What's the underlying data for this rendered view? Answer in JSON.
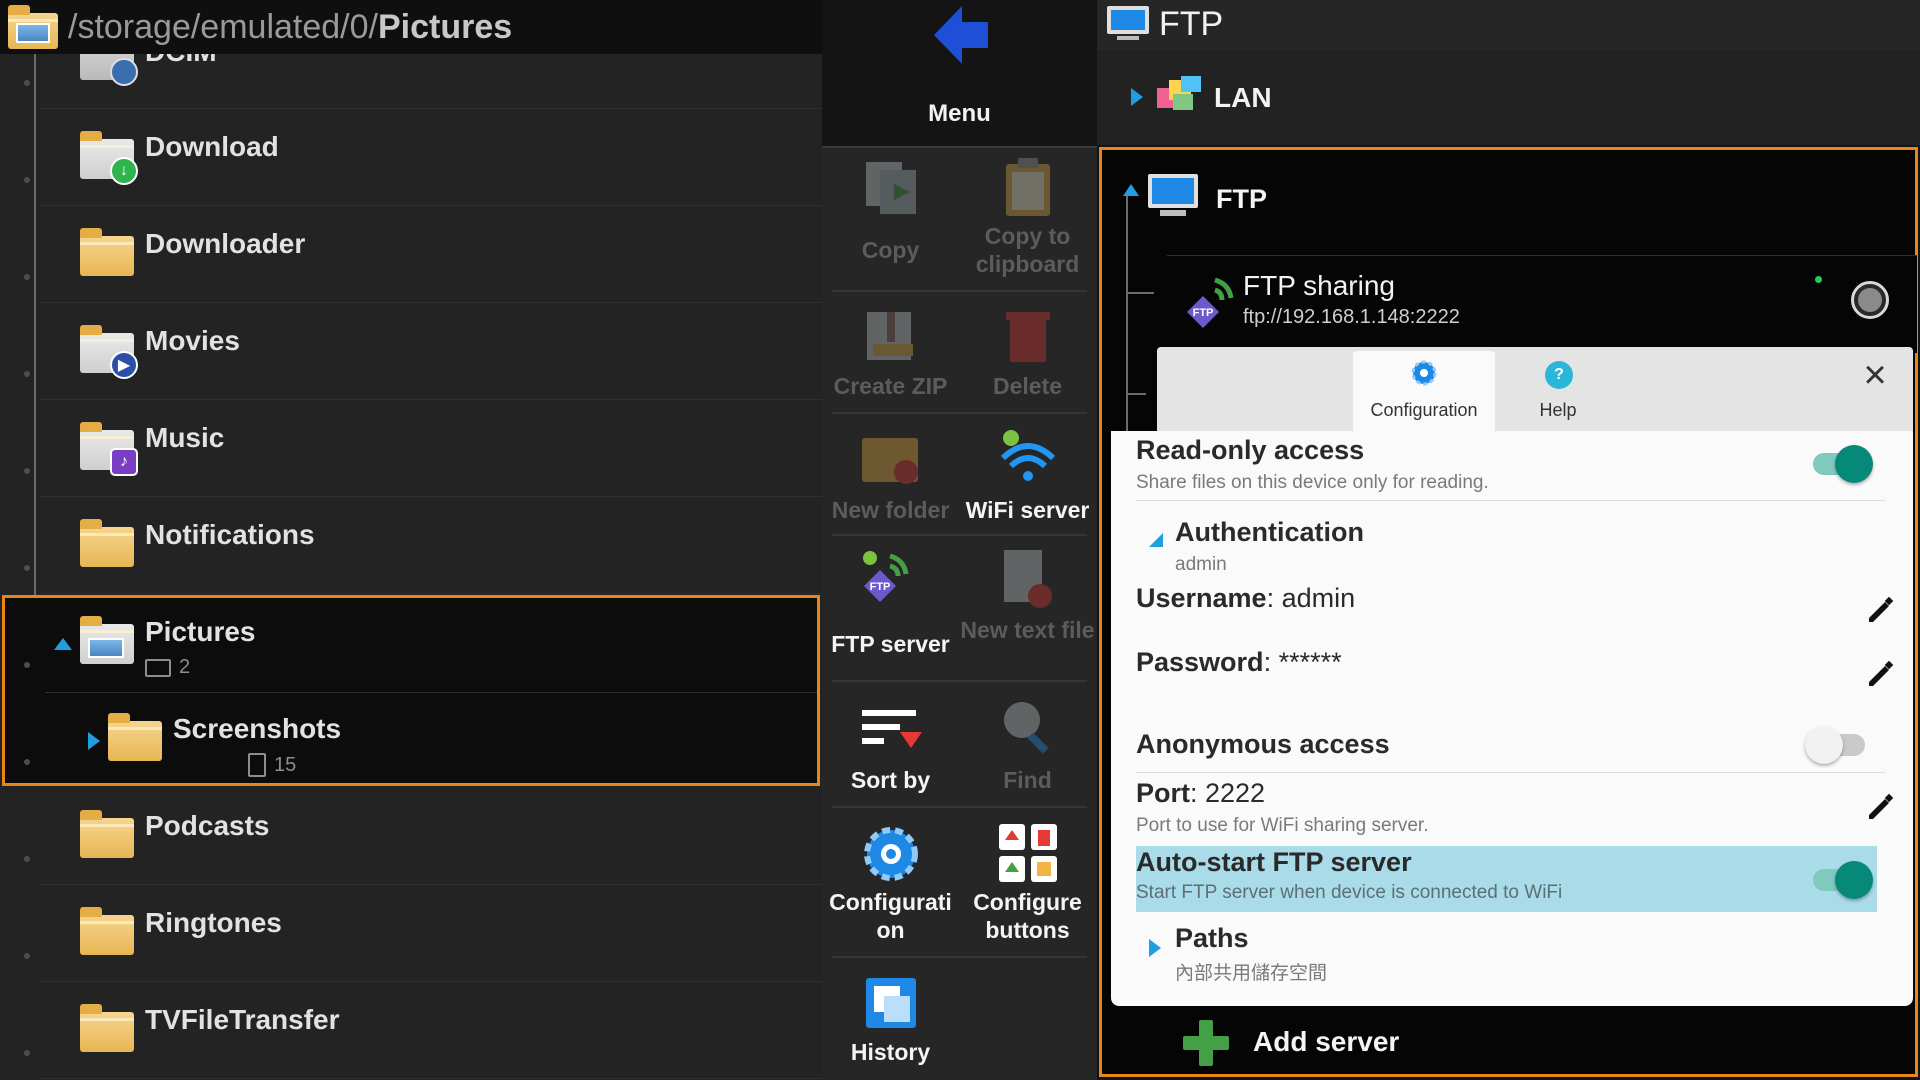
{
  "path_bar": {
    "prefix": "/storage/emulated/0/",
    "current": "Pictures"
  },
  "folders": {
    "dcim": "DCIM",
    "download": "Download",
    "downloader": "Downloader",
    "movies": "Movies",
    "music": "Music",
    "notifications": "Notifications",
    "pictures": "Pictures",
    "pictures_count": "2",
    "screenshots": "Screenshots",
    "screenshots_count": "15",
    "podcasts": "Podcasts",
    "ringtones": "Ringtones",
    "tvfiletransfer": "TVFileTransfer"
  },
  "menu": {
    "title": "Menu",
    "copy": "Copy",
    "copy_clipboard": "Copy to clipboard",
    "create_zip": "Create ZIP",
    "delete": "Delete",
    "new_folder": "New folder",
    "wifi_server": "WiFi server",
    "ftp_server": "FTP server",
    "new_text_file": "New text file",
    "sort_by": "Sort by",
    "find": "Find",
    "configuration": "Configurati on",
    "configure_buttons": "Configure buttons",
    "history": "History"
  },
  "right": {
    "header_title": "FTP",
    "lan": "LAN",
    "ftp_group": "FTP",
    "sharing_name": "FTP sharing",
    "sharing_url": "ftp://192.168.1.148:2222",
    "add_server": "Add server"
  },
  "dialog": {
    "tab_config": "Configuration",
    "tab_help": "Help",
    "readonly_title": "Read-only access",
    "readonly_sub": "Share files on this device only for reading.",
    "readonly_on": true,
    "auth_title": "Authentication",
    "auth_sub": "admin",
    "username_label": "Username",
    "username_value": ": admin",
    "password_label": "Password",
    "password_value": ": ******",
    "anon_title": "Anonymous access",
    "anon_on": false,
    "port_label": "Port",
    "port_value": ": 2222",
    "port_sub": "Port to use for WiFi sharing server.",
    "autostart_title": "Auto-start FTP server",
    "autostart_sub": "Start FTP server when device is connected to WiFi",
    "autostart_on": true,
    "paths_title": "Paths",
    "paths_sub": "內部共用儲存空間"
  },
  "icons": {
    "accent_orange": "#e8861c",
    "toggle_on": "#07897a",
    "highlight": "#aadbe8"
  }
}
